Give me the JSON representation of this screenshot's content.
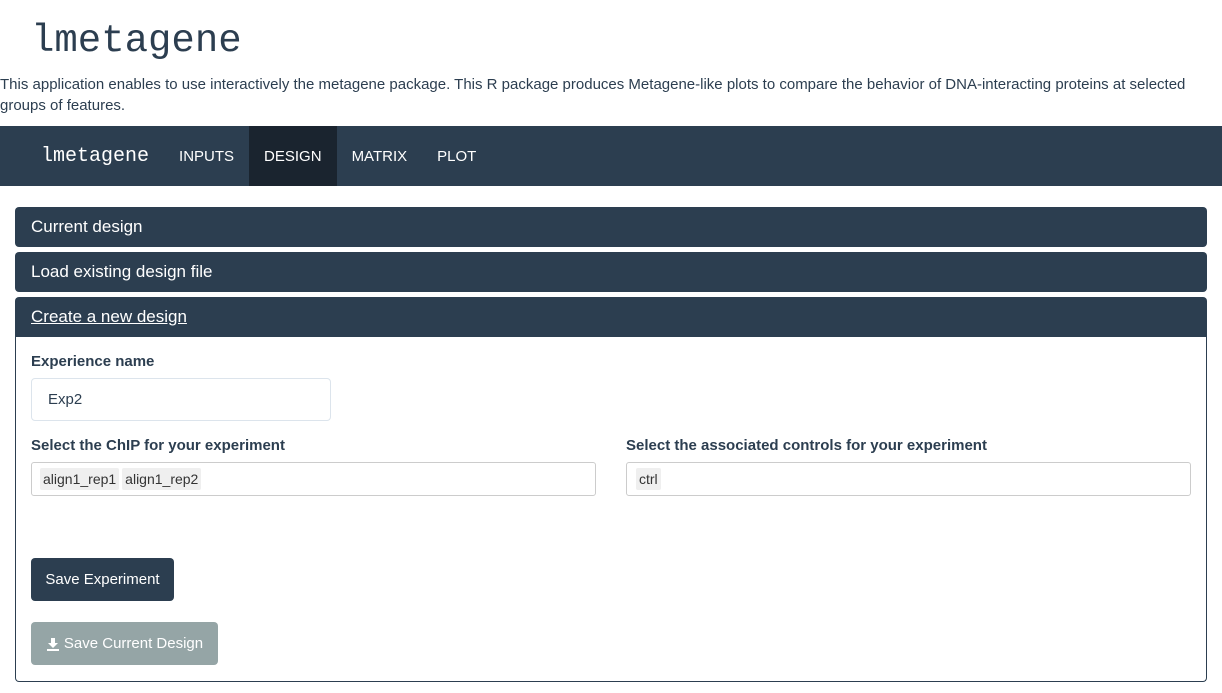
{
  "app": {
    "title": "lmetagene",
    "description": "This application enables to use interactively the metagene package. This R package produces Metagene-like plots to compare the behavior of DNA-interacting proteins at selected groups of features."
  },
  "navbar": {
    "brand": "lmetagene",
    "tabs": [
      {
        "label": "INPUTS",
        "active": false
      },
      {
        "label": "DESIGN",
        "active": true
      },
      {
        "label": "MATRIX",
        "active": false
      },
      {
        "label": "PLOT",
        "active": false
      }
    ]
  },
  "panels": {
    "current_design": "Current design",
    "load_design": "Load existing design file",
    "create_design": "Create a new design"
  },
  "form": {
    "experience_name_label": "Experience name",
    "experience_name_value": "Exp2",
    "chip_label": "Select the ChIP for your experiment",
    "chip_selected": [
      "align1_rep1",
      "align1_rep2"
    ],
    "controls_label": "Select the associated controls for your experiment",
    "controls_selected": [
      "ctrl"
    ],
    "save_experiment_label": "Save Experiment",
    "save_design_label": "Save Current Design",
    "save_design_icon": "download-icon"
  },
  "colors": {
    "primary": "#2c3e50",
    "active_tab": "#1a242f",
    "disabled": "#95a5a6"
  }
}
